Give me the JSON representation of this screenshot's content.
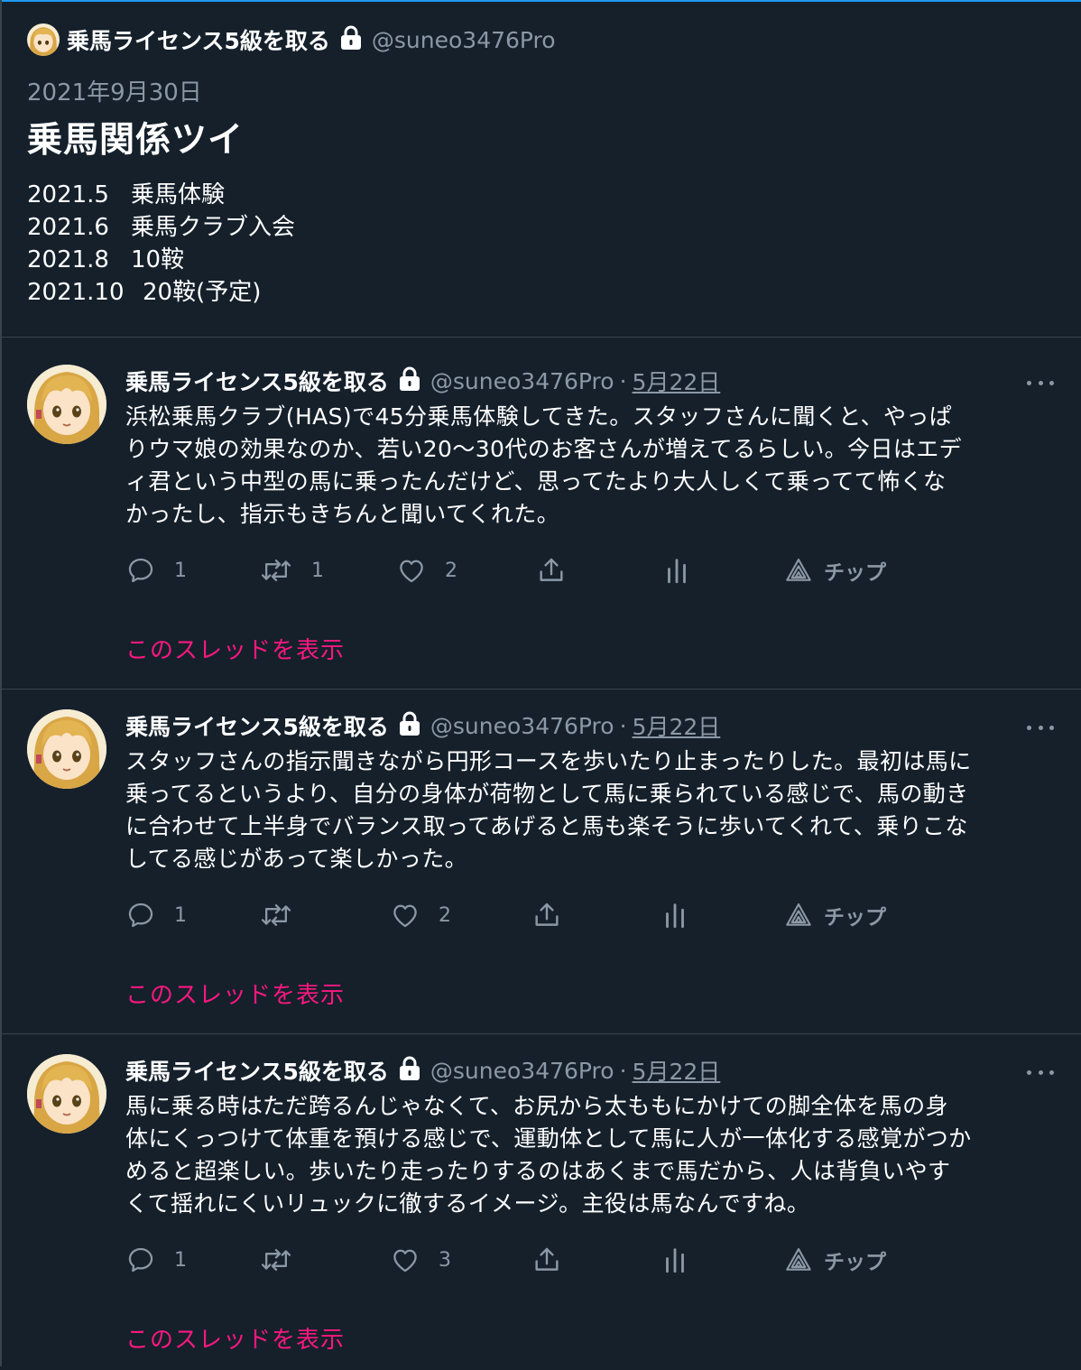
{
  "header": {
    "author_name": "乗馬ライセンス5級を取る",
    "author_handle": "@suneo3476Pro",
    "date": "2021年9月30日",
    "title": "乗馬関係ツイ",
    "timeline": [
      {
        "year": "2021.5",
        "event": "乗馬体験"
      },
      {
        "year": "2021.6",
        "event": "乗馬クラブ入会"
      },
      {
        "year": "2021.8",
        "event": "10鞍"
      },
      {
        "year": "2021.10",
        "event": "20鞍(予定)"
      }
    ]
  },
  "tweets": [
    {
      "name": "乗馬ライセンス5級を取る",
      "handle": "@suneo3476Pro",
      "sep": "·",
      "date": "5月22日",
      "lines": [
        "浜松乗馬クラブ(HAS)で45分乗馬体験してきた。スタッフさんに聞くと、やっぱ",
        "りウマ娘の効果なのか、若い20〜30代のお客さんが増えてるらしい。今日はエデ",
        "ィ君という中型の馬に乗ったんだけど、思ってたより大人しくて乗ってて怖くな",
        "かったし、指示もきちんと聞いてくれた。"
      ],
      "replies": "1",
      "retweets": "1",
      "likes": "2",
      "tip_label": "チップ",
      "thread_link": "このスレッドを表示"
    },
    {
      "name": "乗馬ライセンス5級を取る",
      "handle": "@suneo3476Pro",
      "sep": "·",
      "date": "5月22日",
      "lines": [
        "スタッフさんの指示聞きながら円形コースを歩いたり止まったりした。最初は馬に",
        "乗ってるというより、自分の身体が荷物として馬に乗られている感じで、馬の動き",
        "に合わせて上半身でバランス取ってあげると馬も楽そうに歩いてくれて、乗りこな",
        "してる感じがあって楽しかった。"
      ],
      "replies": "1",
      "retweets": "",
      "likes": "2",
      "tip_label": "チップ",
      "thread_link": "このスレッドを表示"
    },
    {
      "name": "乗馬ライセンス5級を取る",
      "handle": "@suneo3476Pro",
      "sep": "·",
      "date": "5月22日",
      "lines": [
        "馬に乗る時はただ跨るんじゃなくて、お尻から太ももにかけての脚全体を馬の身",
        "体にくっつけて体重を預ける感じで、運動体として馬に人が一体化する感覚がつか",
        "めると超楽しい。歩いたり走ったりするのはあくまで馬だから、人は背負いやす",
        "くて揺れにくいリュックに徹するイメージ。主役は馬なんですね。"
      ],
      "replies": "1",
      "retweets": "",
      "likes": "3",
      "tip_label": "チップ",
      "thread_link": "このスレッドを表示"
    }
  ],
  "icons": {
    "lock": "lock-icon",
    "reply": "reply-icon",
    "retweet": "retweet-icon",
    "like": "heart-icon",
    "share": "share-icon",
    "analytics": "analytics-icon",
    "tip": "tip-icon",
    "more": "more-icon"
  },
  "colors": {
    "background": "#15202b",
    "divider": "#38444d",
    "secondary_text": "#8b98a5",
    "thread_link": "#f91880",
    "top_accent": "#1d9bf0"
  }
}
